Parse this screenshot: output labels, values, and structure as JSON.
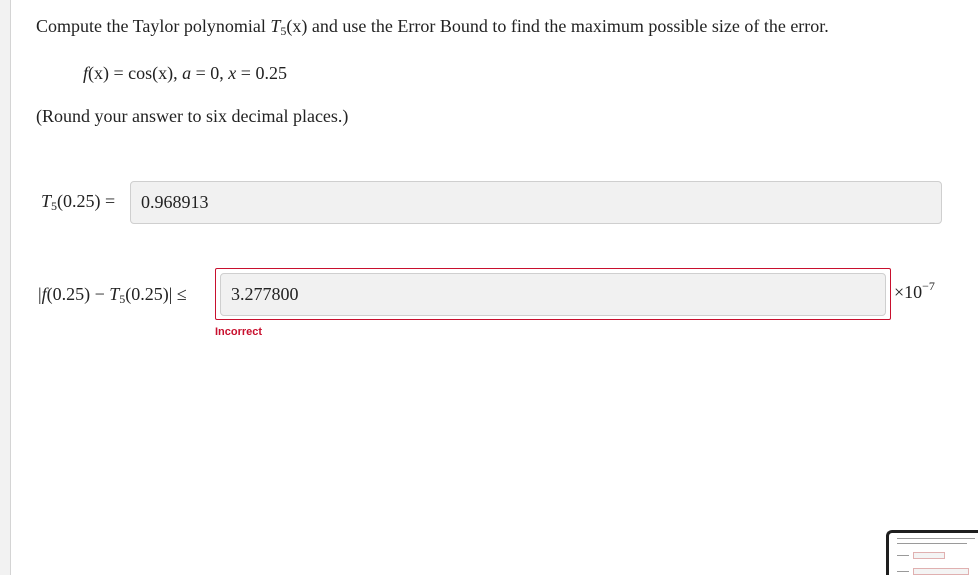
{
  "question": {
    "prefix": "Compute the Taylor polynomial ",
    "poly_symbol": "T",
    "poly_sub": "5",
    "poly_arg": "(x)",
    "suffix": " and use the Error Bound to find the maximum possible size of the error."
  },
  "function_line": {
    "f": "f",
    "fx_rest": "(x) = cos(x), ",
    "a": "a",
    "a_rest": " = 0, ",
    "x": "x",
    "x_rest": " = 0.25"
  },
  "rounding_note": "(Round your answer to six decimal places.)",
  "t5_answer": {
    "label_symbol": "T",
    "label_sub": "5",
    "label_rest": "(0.25) =",
    "value": "0.968913"
  },
  "error_answer": {
    "label_open": "|",
    "label_f": "f",
    "label_mid": "(0.25) − ",
    "label_t": "T",
    "label_sub": "5",
    "label_end": "(0.25)| ≤",
    "value": "3.277800",
    "exponent_prefix": "×10",
    "exponent": "−7",
    "feedback": "Incorrect",
    "feedback_color": "#c8102e"
  }
}
